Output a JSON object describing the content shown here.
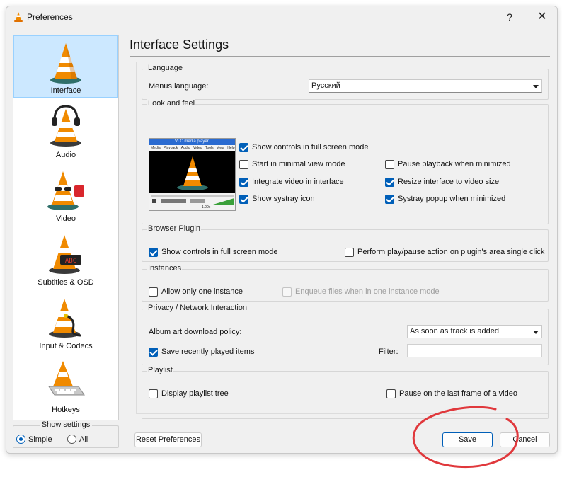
{
  "window": {
    "title": "Preferences",
    "help_glyph": "?",
    "close_glyph": "✕"
  },
  "sidebar": {
    "items": [
      {
        "label": "Interface",
        "icon": "vlc-cone-icon",
        "selected": true
      },
      {
        "label": "Audio",
        "icon": "headphones-cone-icon",
        "selected": false
      },
      {
        "label": "Video",
        "icon": "glasses-cone-icon",
        "selected": false
      },
      {
        "label": "Subtitles & OSD",
        "icon": "subtitle-display-cone-icon",
        "selected": false
      },
      {
        "label": "Input & Codecs",
        "icon": "cable-cone-icon",
        "selected": false
      },
      {
        "label": "Hotkeys",
        "icon": "keyboard-cone-icon",
        "selected": false
      }
    ]
  },
  "show_settings": {
    "title": "Show settings",
    "simple_label": "Simple",
    "all_label": "All",
    "selected": "Simple"
  },
  "main": {
    "title": "Interface Settings",
    "language": {
      "title": "Language",
      "menus_language_label": "Menus language:",
      "menus_language_value": "Русский"
    },
    "look_and_feel": {
      "title": "Look and feel",
      "preview_title": "VLC media player",
      "preview_menu": [
        "Media",
        "Playback",
        "Audio",
        "Video",
        "Tools",
        "View",
        "Help"
      ],
      "preview_speed": "1.00x",
      "options": {
        "show_controls_fullscreen": {
          "label": "Show controls in full screen mode",
          "checked": true
        },
        "minimal_view": {
          "label": "Start in minimal view mode",
          "checked": false
        },
        "pause_minimized": {
          "label": "Pause playback when minimized",
          "checked": false
        },
        "integrate_video": {
          "label": "Integrate video in interface",
          "checked": true
        },
        "resize_interface": {
          "label": "Resize interface to video size",
          "checked": true
        },
        "systray_icon": {
          "label": "Show systray icon",
          "checked": true
        },
        "systray_popup": {
          "label": "Systray popup when minimized",
          "checked": true
        }
      }
    },
    "browser_plugin": {
      "title": "Browser Plugin",
      "show_controls": {
        "label": "Show controls in full screen mode",
        "checked": true
      },
      "play_pause_area": {
        "label": "Perform play/pause action on plugin's area single click",
        "checked": false
      }
    },
    "instances": {
      "title": "Instances",
      "one_instance": {
        "label": "Allow only one instance",
        "checked": false
      },
      "enqueue": {
        "label": "Enqueue files when in one instance mode",
        "checked": false,
        "disabled": true
      }
    },
    "privacy": {
      "title": "Privacy / Network Interaction",
      "album_art_label": "Album art download policy:",
      "album_art_value": "As soon as track is added",
      "save_recent": {
        "label": "Save recently played items",
        "checked": true
      },
      "filter_label": "Filter:",
      "filter_value": ""
    },
    "playlist": {
      "title": "Playlist",
      "display_tree": {
        "label": "Display playlist tree",
        "checked": false
      },
      "pause_last_frame": {
        "label": "Pause on the last frame of a video",
        "checked": false
      }
    }
  },
  "footer": {
    "reset_label": "Reset Preferences",
    "save_label": "Save",
    "cancel_label": "Cancel"
  },
  "colors": {
    "accent": "#005fb8",
    "selection_bg": "#cce8ff",
    "cone_orange": "#f08a00",
    "annotation_red": "#e0383c"
  }
}
